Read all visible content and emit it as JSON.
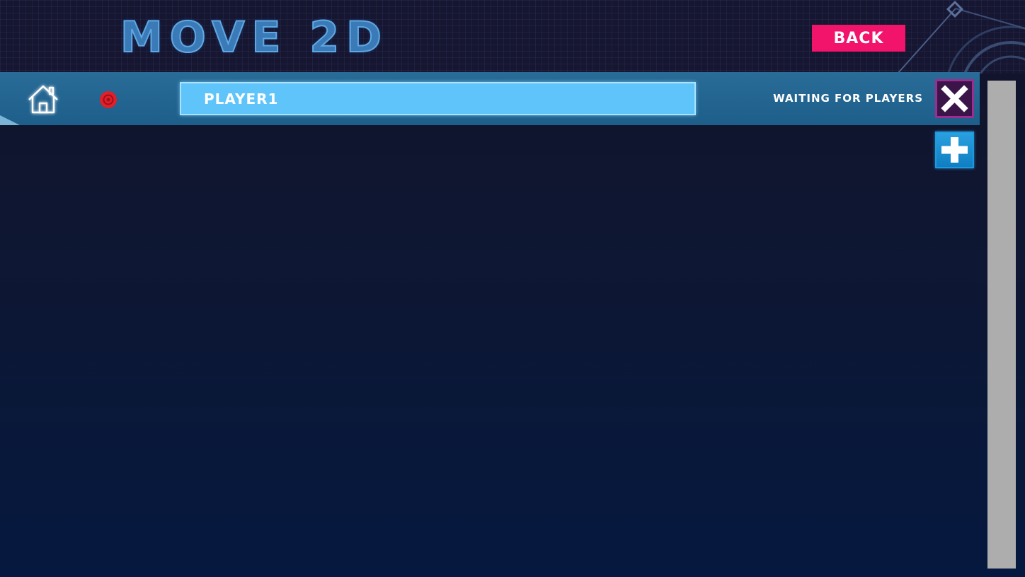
{
  "header": {
    "logo_text": "MOVE 2D",
    "back_label": "BACK"
  },
  "player_row": {
    "player_name": "PLAYER1",
    "status_text": "WAITING FOR PLAYERS"
  },
  "colors": {
    "back_button": "#f2136b",
    "player_bar": "#1d5e8a",
    "name_field": "#5ec4fa",
    "status_dot": "#e0202a",
    "remove_button_border": "#9c2e91",
    "add_button": "#1a9be0",
    "scrollbar": "#adadad"
  },
  "icons": {
    "home": "home-icon",
    "status": "record-dot-icon",
    "remove": "close-icon",
    "add": "plus-icon"
  }
}
